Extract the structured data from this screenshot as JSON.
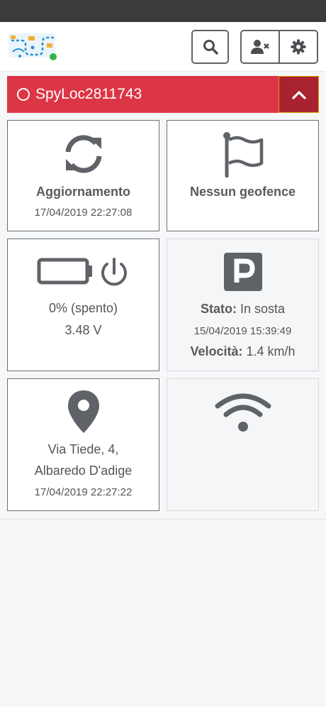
{
  "header": {
    "logo_icon": "map-route-logo-icon",
    "search_icon": "search-icon",
    "remove_user_icon": "user-remove-icon",
    "settings_icon": "gear-icon"
  },
  "device": {
    "name": "SpyLoc2811743",
    "status_icon": "circle-outline-icon",
    "toggle_icon": "chevron-up-icon",
    "bar_color": "#dc3545"
  },
  "cards": {
    "update": {
      "icon": "sync-icon",
      "title": "Aggiornamento",
      "timestamp": "17/04/2019 22:27:08"
    },
    "geofence": {
      "icon": "flag-icon",
      "title": "Nessun geofence"
    },
    "battery": {
      "icon": "battery-empty-icon",
      "power_icon": "power-icon",
      "level_text": "0% (spento)",
      "voltage": "3.48 V"
    },
    "status": {
      "icon": "parking-icon",
      "state_label": "Stato:",
      "state_value": "In sosta",
      "timestamp": "15/04/2019 15:39:49",
      "speed_label": "Velocità:",
      "speed_value": "1.4 km/h"
    },
    "location": {
      "icon": "map-marker-icon",
      "address_line1": "Via Tiede, 4,",
      "address_line2": "Albaredo D'adige",
      "timestamp": "17/04/2019 22:27:22"
    },
    "signal": {
      "icon": "wifi-icon"
    }
  }
}
